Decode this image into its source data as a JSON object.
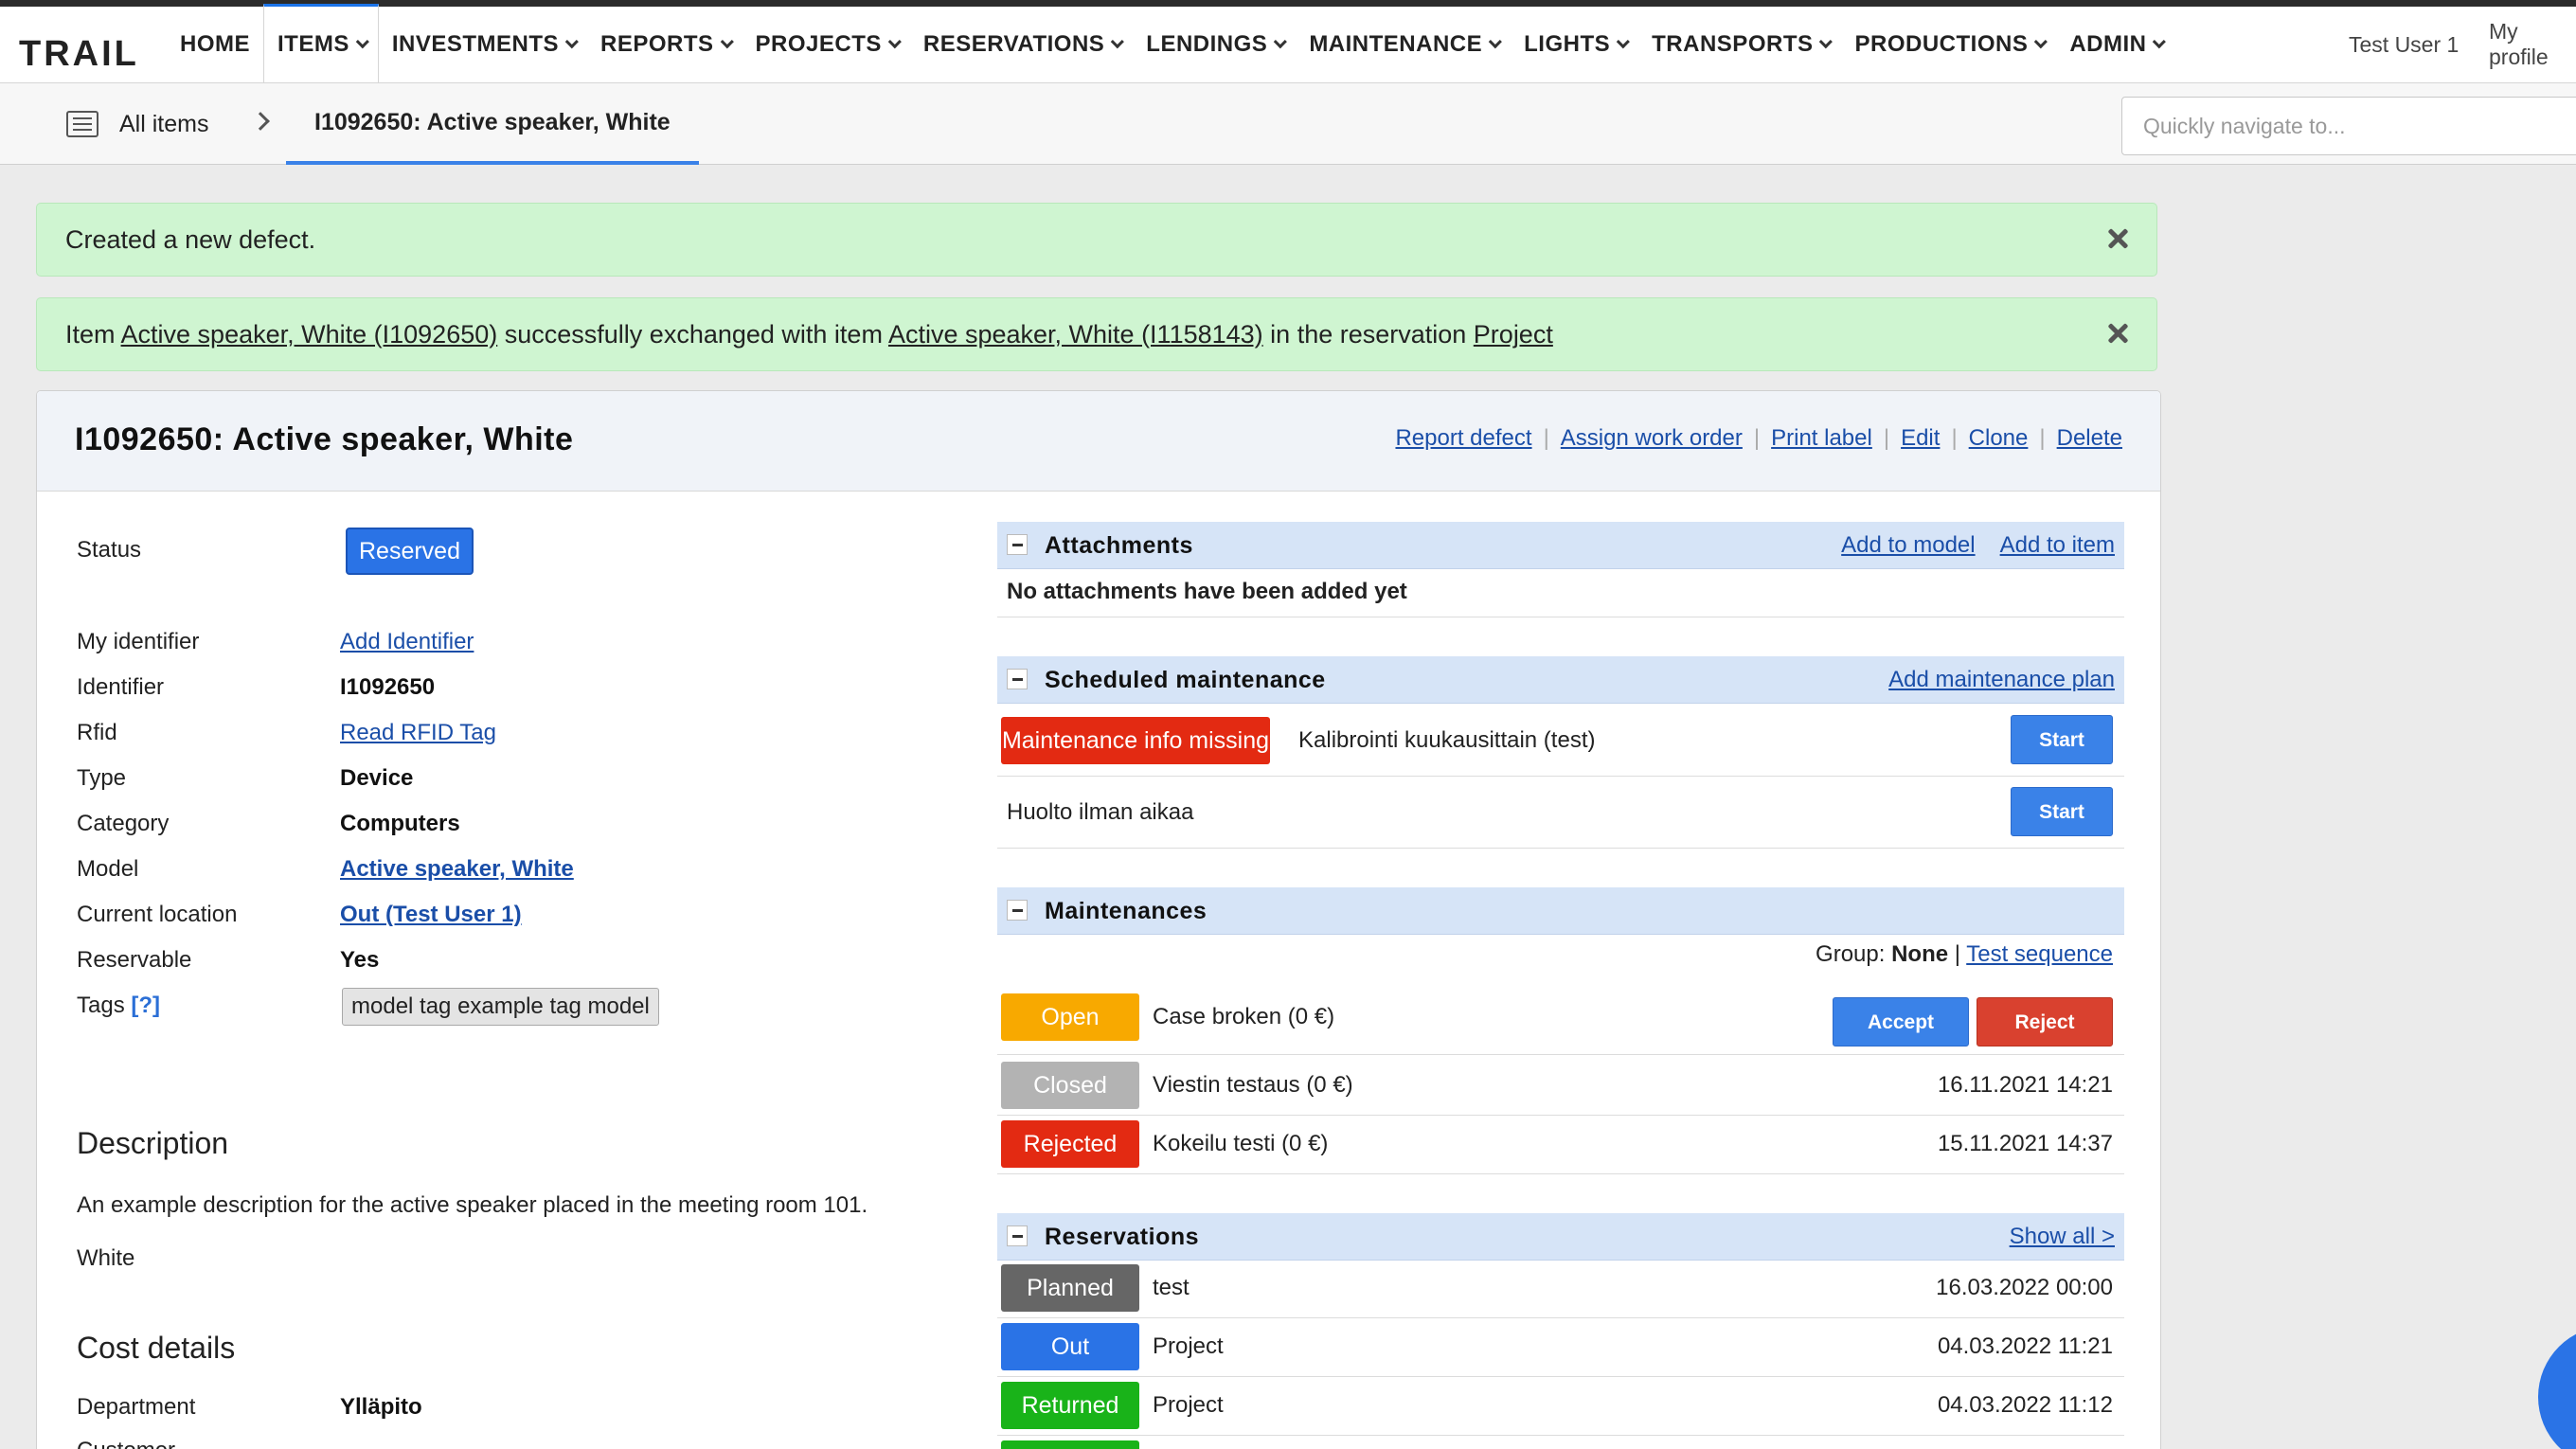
{
  "app": {
    "logo_text": "TRAIL"
  },
  "nav": {
    "items": [
      {
        "label": "HOME",
        "caret": false
      },
      {
        "label": "ITEMS",
        "caret": true
      },
      {
        "label": "INVESTMENTS",
        "caret": true
      },
      {
        "label": "REPORTS",
        "caret": true
      },
      {
        "label": "PROJECTS",
        "caret": true
      },
      {
        "label": "RESERVATIONS",
        "caret": true
      },
      {
        "label": "LENDINGS",
        "caret": true
      },
      {
        "label": "MAINTENANCE",
        "caret": true
      },
      {
        "label": "LIGHTS",
        "caret": true
      },
      {
        "label": "TRANSPORTS",
        "caret": true
      },
      {
        "label": "PRODUCTIONS",
        "caret": true
      },
      {
        "label": "ADMIN",
        "caret": true
      }
    ],
    "active_index": 1,
    "user": "Test User 1",
    "profile": "My profile"
  },
  "breadcrumb": {
    "all_items": "All items",
    "current": "I1092650: Active speaker, White"
  },
  "search": {
    "placeholder": "Quickly navigate to..."
  },
  "alerts": {
    "defect": "Created a new defect.",
    "exchange": {
      "prefix": "Item ",
      "item1": "Active speaker, White (I1092650)",
      "mid": " successfully exchanged with item ",
      "item2": "Active speaker, White (I1158143)",
      "mid2": " in the reservation ",
      "reservation": "Project"
    }
  },
  "item": {
    "title": "I1092650: Active speaker, White",
    "actions": [
      "Report defect",
      "Assign work order",
      "Print label",
      "Edit",
      "Clone",
      "Delete"
    ],
    "status_label": "Status",
    "status": "Reserved",
    "fields": {
      "my_identifier": {
        "label": "My identifier",
        "value": "Add Identifier"
      },
      "identifier": {
        "label": "Identifier",
        "value": "I1092650"
      },
      "rfid": {
        "label": "Rfid",
        "value": "Read RFID Tag"
      },
      "type": {
        "label": "Type",
        "value": "Device"
      },
      "category": {
        "label": "Category",
        "value": "Computers"
      },
      "model": {
        "label": "Model",
        "value": "Active speaker, White"
      },
      "location": {
        "label": "Current location",
        "value": "Out (Test User 1)"
      },
      "reservable": {
        "label": "Reservable",
        "value": "Yes"
      },
      "tags": {
        "label": "Tags",
        "help": "[?]",
        "value": "model tag example tag model"
      }
    },
    "description_heading": "Description",
    "description": "An example description for the active speaker placed in the meeting room 101.",
    "color": "White",
    "cost_heading": "Cost details",
    "department_label": "Department",
    "department": "Ylläpito",
    "customer_label": "Customer"
  },
  "attachments": {
    "title": "Attachments",
    "add_model": "Add to model",
    "add_item": "Add to item",
    "empty": "No attachments have been added yet"
  },
  "scheduled": {
    "title": "Scheduled maintenance",
    "add": "Add maintenance plan",
    "rows": [
      {
        "badge": "Maintenance info missing",
        "name": "Kalibrointi kuukausittain (test)",
        "button": "Start"
      },
      {
        "name": "Huolto ilman aikaa",
        "button": "Start"
      }
    ]
  },
  "maintenances": {
    "title": "Maintenances",
    "group_label": "Group: ",
    "group_value": "None",
    "group_sep": " | ",
    "sequence": "Test sequence",
    "rows": [
      {
        "status": "Open",
        "name": "Case broken (0 €)",
        "accept": "Accept",
        "reject": "Reject"
      },
      {
        "status": "Closed",
        "name": "Viestin testaus (0 €)",
        "date": "16.11.2021 14:21"
      },
      {
        "status": "Rejected",
        "name": "Kokeilu testi (0 €)",
        "date": "15.11.2021 14:37"
      }
    ]
  },
  "reservations": {
    "title": "Reservations",
    "show_all": "Show all >",
    "rows": [
      {
        "status": "Planned",
        "name": "test",
        "date": "16.03.2022 00:00"
      },
      {
        "status": "Out",
        "name": "Project",
        "date": "04.03.2022 11:21"
      },
      {
        "status": "Returned",
        "name": "Project",
        "date": "04.03.2022 11:12"
      }
    ]
  },
  "colors": {
    "primary": "#3a82e8",
    "open": "#f8a900",
    "closed": "#b3b3b3",
    "rejected": "#e32a12",
    "planned": "#666666",
    "out": "#2a73e6",
    "returned": "#19b319",
    "alert_bg": "#cff5d1",
    "box_head": "#d6e4f7"
  }
}
